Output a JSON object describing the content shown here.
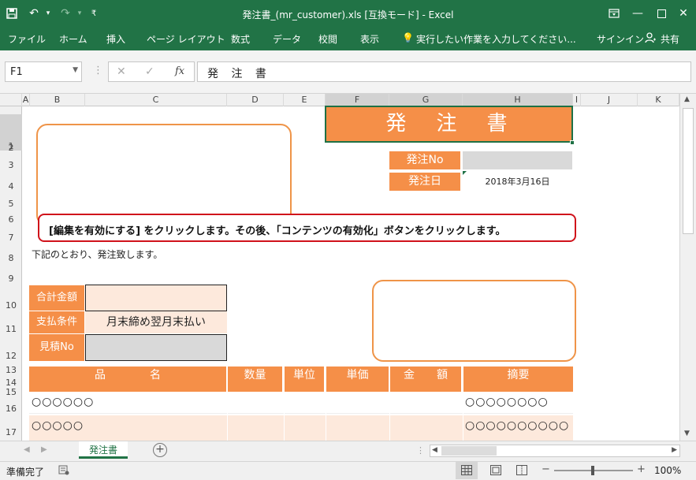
{
  "titlebar": {
    "title": "発注書_(mr_customer).xls [互換モード] - Excel"
  },
  "ribbon": {
    "tabs": [
      "ファイル",
      "ホーム",
      "挿入",
      "ページ レイアウト",
      "数式",
      "データ",
      "校閲",
      "表示"
    ],
    "tell_me": "実行したい作業を入力してください...",
    "signin": "サインイン",
    "share": "共有"
  },
  "formula_bar": {
    "name_box": "F1",
    "cancel_icon": "✕",
    "enter_icon": "✓",
    "fx_label": "fx",
    "content": "発 注 書"
  },
  "columns": [
    "A",
    "B",
    "C",
    "D",
    "E",
    "F",
    "G",
    "H",
    "I",
    "J",
    "K"
  ],
  "rows": [
    "1",
    "2",
    "3",
    "4",
    "5",
    "6",
    "7",
    "8",
    "9",
    "10",
    "11",
    "12",
    "13",
    "14",
    "15",
    "16",
    "17"
  ],
  "sheet": {
    "title": "発　注　書",
    "order_no_label": "発注No",
    "order_date_label": "発注日",
    "order_date_value": "2018年3月16日",
    "notice": "[編集を有効にする] をクリックします。その後、「コンテンツの有効化」ボタンをクリックします。",
    "intro": "下記のとおり、発注致します。",
    "total_label": "合計金額",
    "payment_label": "支払条件",
    "payment_value": "月末締め翌月末払い",
    "estimate_label": "見積No",
    "table_headers": {
      "item": "品　　　　名",
      "qty": "数量",
      "unit": "単位",
      "price": "単価",
      "amount": "金　　額",
      "note": "摘要"
    },
    "rows": [
      {
        "item": "○○○○○○",
        "note": "○○○○○○○○"
      },
      {
        "item": "○○○○○",
        "note": "○○○○○○○○○○"
      }
    ]
  },
  "sheet_tabs": [
    "発注書"
  ],
  "status": {
    "ready": "準備完了",
    "zoom": "100%"
  },
  "colors": {
    "excel_green": "#217346",
    "accent_orange": "#f58f48",
    "peach": "#fde9dc",
    "notice_border": "#d0121b"
  }
}
